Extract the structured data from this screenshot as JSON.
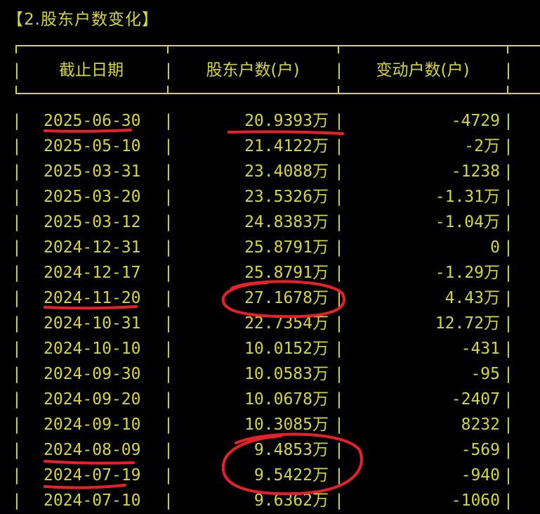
{
  "section_title": "【2.股东户数变化】",
  "table": {
    "columns": [
      "截止日期",
      "股东户数(户)",
      "变动户数(户)"
    ],
    "rows": [
      {
        "date": "2025-06-30",
        "holders": "20.9393万",
        "change": "-4729"
      },
      {
        "date": "2025-05-10",
        "holders": "21.4122万",
        "change": "-2万"
      },
      {
        "date": "2025-03-31",
        "holders": "23.4088万",
        "change": "-1238"
      },
      {
        "date": "2025-03-20",
        "holders": "23.5326万",
        "change": "-1.31万"
      },
      {
        "date": "2025-03-12",
        "holders": "24.8383万",
        "change": "-1.04万"
      },
      {
        "date": "2024-12-31",
        "holders": "25.8791万",
        "change": "0"
      },
      {
        "date": "2024-12-17",
        "holders": "25.8791万",
        "change": "-1.29万"
      },
      {
        "date": "2024-11-20",
        "holders": "27.1678万",
        "change": "4.43万"
      },
      {
        "date": "2024-10-31",
        "holders": "22.7354万",
        "change": "12.72万"
      },
      {
        "date": "2024-10-10",
        "holders": "10.0152万",
        "change": "-431"
      },
      {
        "date": "2024-09-30",
        "holders": "10.0583万",
        "change": "-95"
      },
      {
        "date": "2024-09-20",
        "holders": "10.0678万",
        "change": "-2407"
      },
      {
        "date": "2024-09-10",
        "holders": "10.3085万",
        "change": "8232"
      },
      {
        "date": "2024-08-09",
        "holders": "9.4853万",
        "change": "-569"
      },
      {
        "date": "2024-07-19",
        "holders": "9.5422万",
        "change": "-940"
      },
      {
        "date": "2024-07-10",
        "holders": "9.6362万",
        "change": "-1060"
      }
    ]
  },
  "colors": {
    "background": "#000000",
    "text": "#d6d63a",
    "annotation": "#e8202a"
  }
}
